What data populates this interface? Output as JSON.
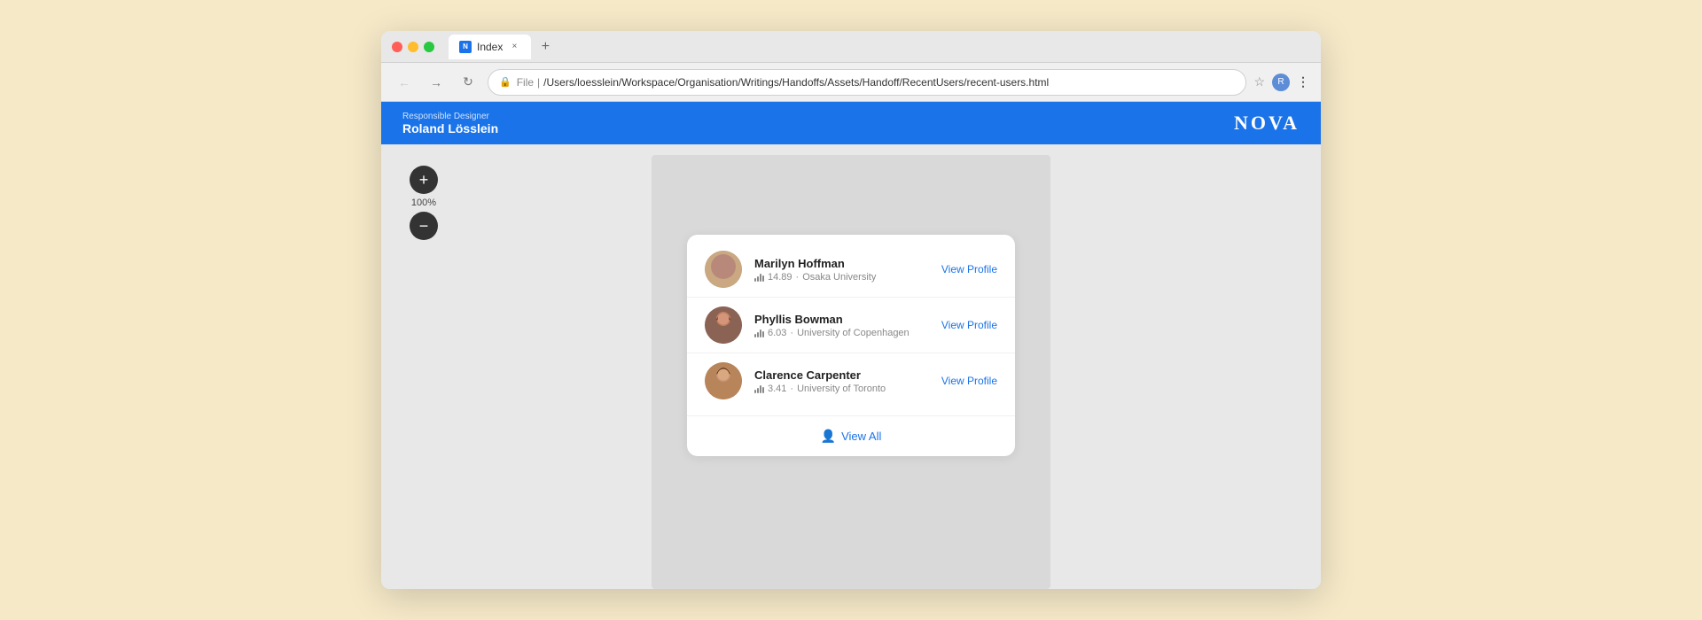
{
  "browser": {
    "tab_title": "Index",
    "tab_favicon": "N",
    "url_file_label": "File",
    "url_path": "/Users/loesslein/Workspace/Organisation/Writings/Handoffs/Assets/Handoff/RecentUsers/recent-users.html",
    "nav_back": "←",
    "nav_forward": "→",
    "nav_reload": "↻",
    "tab_close": "×",
    "tab_new": "+"
  },
  "header": {
    "subtitle": "Responsible Designer",
    "title": "Roland Lösslein",
    "logo": "NOVA"
  },
  "zoom": {
    "plus": "+",
    "minus": "−",
    "level": "100%"
  },
  "user_card": {
    "users": [
      {
        "id": "marilyn",
        "name": "Marilyn Hoffman",
        "score": "14.89",
        "university": "Osaka University",
        "view_profile": "View Profile"
      },
      {
        "id": "phyllis",
        "name": "Phyllis Bowman",
        "score": "6.03",
        "university": "University of Copenhagen",
        "view_profile": "View Profile"
      },
      {
        "id": "clarence",
        "name": "Clarence Carpenter",
        "score": "3.41",
        "university": "University of Toronto",
        "view_profile": "View Profile"
      }
    ],
    "view_all_label": "View All"
  }
}
